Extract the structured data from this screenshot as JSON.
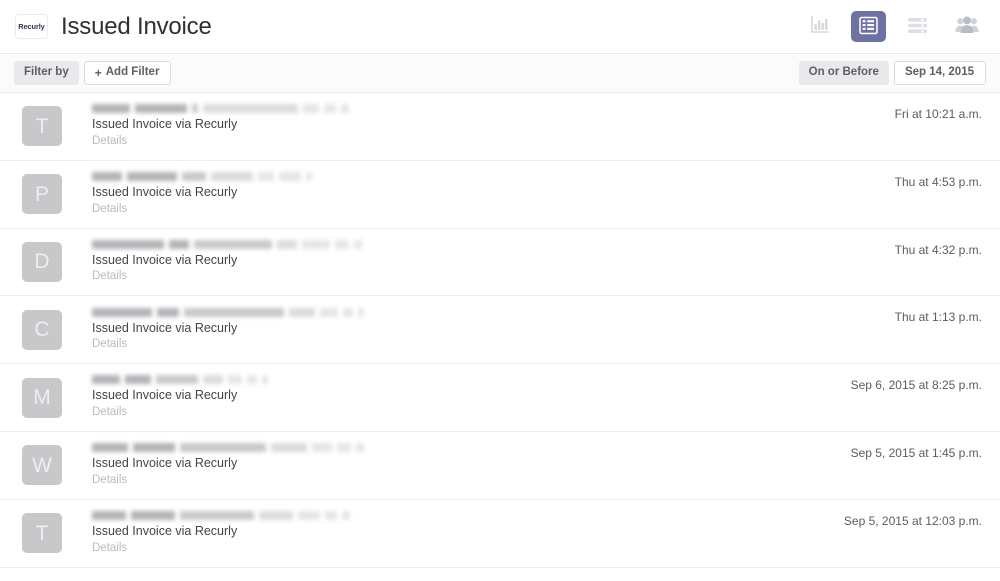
{
  "header": {
    "logo_text": "Recurly",
    "title": "Issued Invoice",
    "actions": [
      {
        "name": "bar-chart-icon",
        "label": "Reports",
        "active": false
      },
      {
        "name": "list-icon",
        "label": "Activity List",
        "active": true
      },
      {
        "name": "feed-icon",
        "label": "Feed",
        "active": false
      },
      {
        "name": "people-icon",
        "label": "People",
        "active": false
      }
    ]
  },
  "filterbar": {
    "filter_by_label": "Filter by",
    "add_filter_label": "Add Filter",
    "add_filter_plus": "+",
    "date_operator_label": "On or Before",
    "date_value": "Sep 14, 2015"
  },
  "list": {
    "action_text": "Issued Invoice via Recurly",
    "details_label": "Details",
    "rows": [
      {
        "avatar_letter": "T",
        "action": "Issued Invoice via Recurly",
        "details": "Details",
        "time": "Fri at 10:21 a.m.",
        "redacted_widths": [
          38,
          52,
          6,
          95,
          16,
          12,
          8
        ]
      },
      {
        "avatar_letter": "P",
        "action": "Issued Invoice via Recurly",
        "details": "Details",
        "time": "Thu at 4:53 p.m.",
        "redacted_widths": [
          30,
          50,
          24,
          42,
          16,
          22,
          6
        ]
      },
      {
        "avatar_letter": "D",
        "action": "Issued Invoice via Recurly",
        "details": "Details",
        "time": "Thu at 4:32 p.m.",
        "redacted_widths": [
          72,
          20,
          78,
          20,
          28,
          14,
          8
        ]
      },
      {
        "avatar_letter": "C",
        "action": "Issued Invoice via Recurly",
        "details": "Details",
        "time": "Thu at 1:13 p.m.",
        "redacted_widths": [
          60,
          22,
          100,
          26,
          18,
          10,
          6
        ]
      },
      {
        "avatar_letter": "M",
        "action": "Issued Invoice via Recurly",
        "details": "Details",
        "time": "Sep 6, 2015 at 8:25 p.m.",
        "redacted_widths": [
          28,
          26,
          42,
          20,
          14,
          10,
          6
        ]
      },
      {
        "avatar_letter": "W",
        "action": "Issued Invoice via Recurly",
        "details": "Details",
        "time": "Sep 5, 2015 at 1:45 p.m.",
        "redacted_widths": [
          36,
          42,
          86,
          36,
          20,
          14,
          8
        ]
      },
      {
        "avatar_letter": "T",
        "action": "Issued Invoice via Recurly",
        "details": "Details",
        "time": "Sep 5, 2015 at 12:03 p.m.",
        "redacted_widths": [
          34,
          44,
          74,
          34,
          22,
          12,
          8
        ]
      }
    ]
  },
  "colors": {
    "accent": "#6e72a0",
    "icon_gray": "#d2d4dc",
    "avatar_bg": "#c8c8ca",
    "text_primary": "#2f3033",
    "divider": "#eeeef0"
  }
}
